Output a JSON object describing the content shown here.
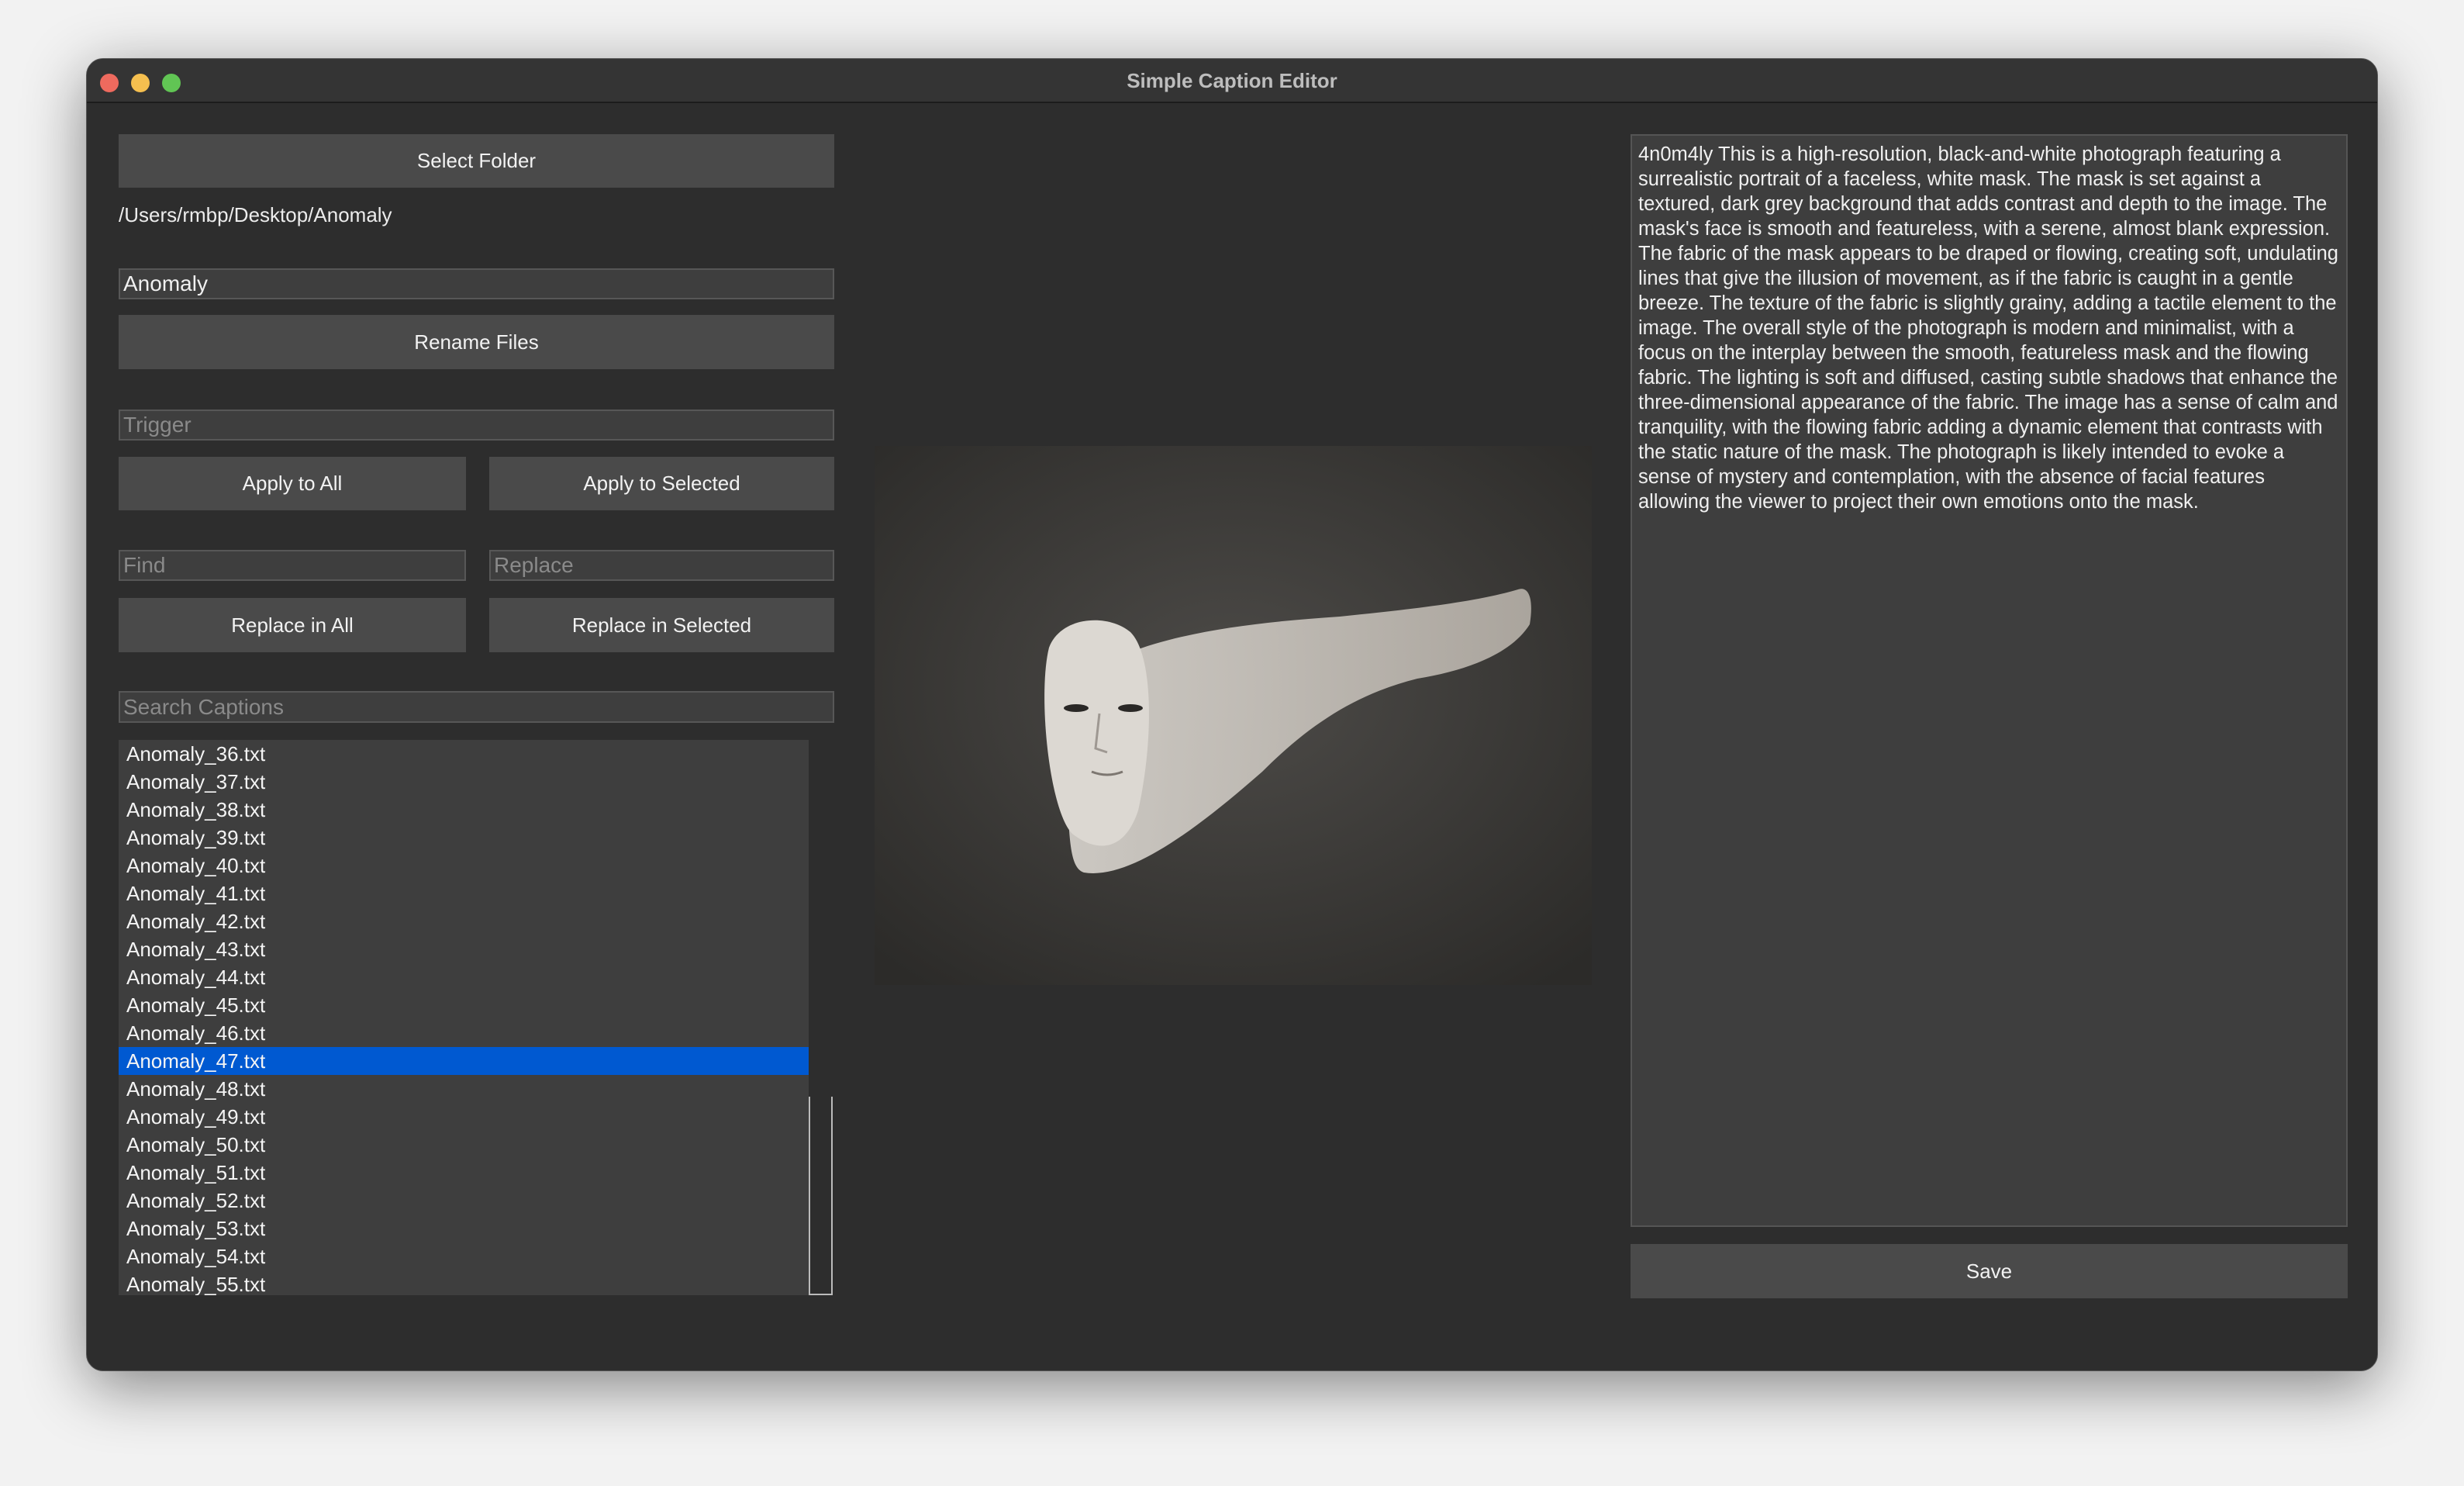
{
  "window": {
    "title": "Simple Caption Editor"
  },
  "left": {
    "select_folder": "Select Folder",
    "folder_path": "/Users/rmbp/Desktop/Anomaly",
    "rename_value": "Anomaly",
    "rename_button": "Rename Files",
    "trigger_placeholder": "Trigger",
    "apply_all": "Apply to All",
    "apply_selected": "Apply to Selected",
    "find_placeholder": "Find",
    "replace_placeholder": "Replace",
    "replace_all": "Replace in All",
    "replace_selected": "Replace in Selected",
    "search_placeholder": "Search Captions",
    "files": [
      "Anomaly_36.txt",
      "Anomaly_37.txt",
      "Anomaly_38.txt",
      "Anomaly_39.txt",
      "Anomaly_40.txt",
      "Anomaly_41.txt",
      "Anomaly_42.txt",
      "Anomaly_43.txt",
      "Anomaly_44.txt",
      "Anomaly_45.txt",
      "Anomaly_46.txt",
      "Anomaly_47.txt",
      "Anomaly_48.txt",
      "Anomaly_49.txt",
      "Anomaly_50.txt",
      "Anomaly_51.txt",
      "Anomaly_52.txt",
      "Anomaly_53.txt",
      "Anomaly_54.txt",
      "Anomaly_55.txt"
    ],
    "selected_file": "Anomaly_47.txt"
  },
  "caption": {
    "text": "4n0m4ly This is a high-resolution, black-and-white photograph featuring a surrealistic portrait of a faceless, white mask. The mask is set against a textured, dark grey background that adds contrast and depth to the image. The mask's face is smooth and featureless, with a serene, almost blank expression. The fabric of the mask appears to be draped or flowing, creating soft, undulating lines that give the illusion of movement, as if the fabric is caught in a gentle breeze. The texture of the fabric is slightly grainy, adding a tactile element to the image. The overall style of the photograph is modern and minimalist, with a focus on the interplay between the smooth, featureless mask and the flowing fabric. The lighting is soft and diffused, casting subtle shadows that enhance the three-dimensional appearance of the fabric. The image has a sense of calm and tranquility, with the flowing fabric adding a dynamic element that contrasts with the static nature of the mask. The photograph is likely intended to evoke a sense of mystery and contemplation, with the absence of facial features allowing the viewer to project their own emotions onto the mask.",
    "save": "Save"
  },
  "colors": {
    "selection": "#0059d1",
    "close": "#ee6a5e",
    "minimize": "#f5bf4f",
    "zoom": "#61c554"
  }
}
